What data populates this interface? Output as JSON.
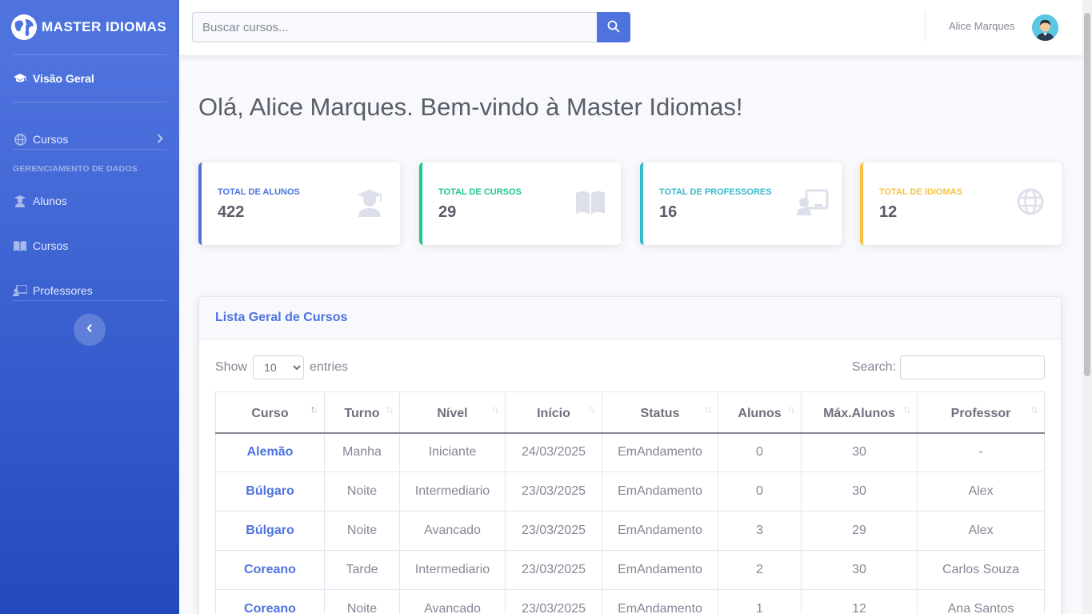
{
  "brand": {
    "name": "MASTER IDIOMAS"
  },
  "sidebar": {
    "overview": "Visão Geral",
    "cursos_menu": "Cursos",
    "section_heading": "GERENCIAMENTO DE DADOS",
    "items": [
      "Alunos",
      "Cursos",
      "Professores"
    ]
  },
  "topbar": {
    "search_placeholder": "Buscar cursos...",
    "user_name": "Alice Marques"
  },
  "main": {
    "greeting": "Olá, Alice Marques. Bem-vindo à Master Idiomas!"
  },
  "stats": [
    {
      "label": "TOTAL DE ALUNOS",
      "value": "422",
      "color": "#4e73df",
      "icon": "graduate-icon"
    },
    {
      "label": "TOTAL DE CURSOS",
      "value": "29",
      "color": "#1cc88a",
      "icon": "book-icon"
    },
    {
      "label": "TOTAL DE PROFESSORES",
      "value": "16",
      "color": "#36b9cc",
      "icon": "teacher-icon"
    },
    {
      "label": "TOTAL DE IDIOMAS",
      "value": "12",
      "color": "#f6c23e",
      "icon": "globe-icon"
    }
  ],
  "table": {
    "title": "Lista Geral de Cursos",
    "show_label": "Show",
    "entries_label": "entries",
    "entries_value": "10",
    "search_label": "Search:",
    "columns": [
      "Curso",
      "Turno",
      "Nível",
      "Início",
      "Status",
      "Alunos",
      "Máx.Alunos",
      "Professor"
    ],
    "rows": [
      [
        "Alemão",
        "Manha",
        "Iniciante",
        "24/03/2025",
        "EmAndamento",
        "0",
        "30",
        "-"
      ],
      [
        "Búlgaro",
        "Noite",
        "Intermediario",
        "23/03/2025",
        "EmAndamento",
        "0",
        "30",
        "Alex"
      ],
      [
        "Búlgaro",
        "Noite",
        "Avancado",
        "23/03/2025",
        "EmAndamento",
        "3",
        "29",
        "Alex"
      ],
      [
        "Coreano",
        "Tarde",
        "Intermediario",
        "23/03/2025",
        "EmAndamento",
        "2",
        "30",
        "Carlos Souza"
      ],
      [
        "Coreano",
        "Noite",
        "Avancado",
        "23/03/2025",
        "EmAndamento",
        "1",
        "12",
        "Ana Santos"
      ]
    ]
  }
}
